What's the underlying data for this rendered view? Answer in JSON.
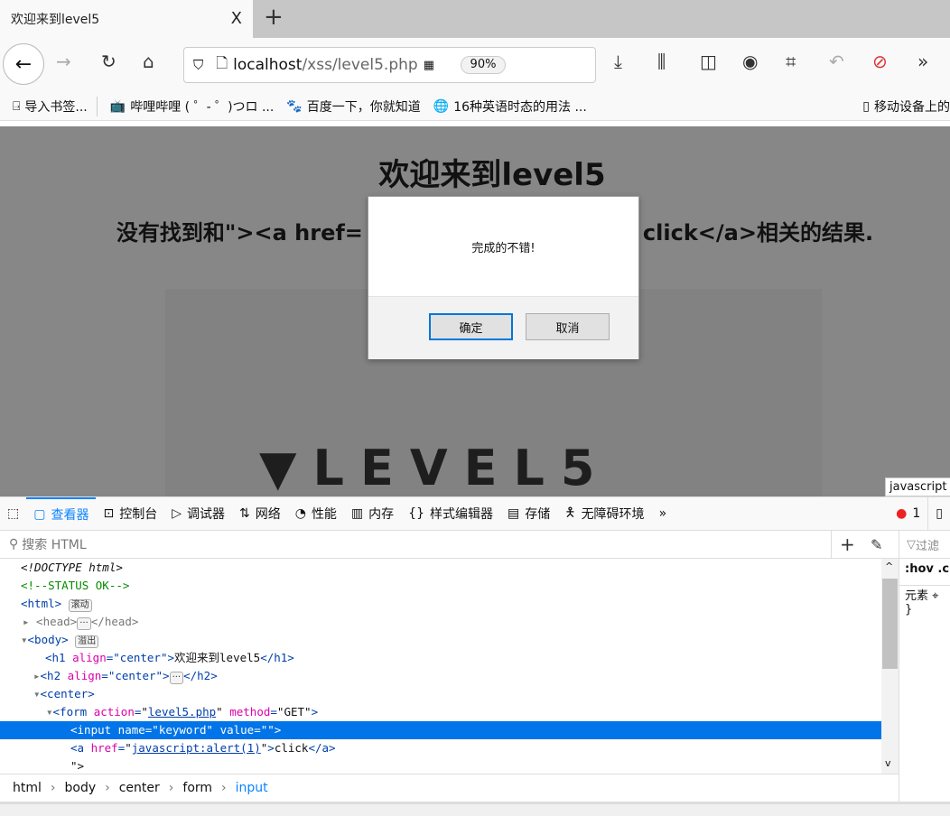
{
  "tab": {
    "title": "欢迎来到level5",
    "close": "X",
    "new": "+"
  },
  "nav": {
    "url_host": "localhost",
    "url_path": "/xss/level5.php",
    "zoom": "90%"
  },
  "bookmarks": [
    "导入书签...",
    "哔哩哔哩 ( ゜- ゜)つロ ...",
    "百度一下，你就知道",
    "16种英语时态的用法 ...",
    "移动设备上的"
  ],
  "page": {
    "h1": "欢迎来到level5",
    "h2_left": "没有找到和\"><a href=",
    "h2_right": "click</a>相关的结果.",
    "logo": "LEVEL5",
    "tooltip": "javascript"
  },
  "dialog": {
    "message": "完成的不错!",
    "ok": "确定",
    "cancel": "取消"
  },
  "devtools": {
    "tabs": [
      "查看器",
      "控制台",
      "调试器",
      "网络",
      "性能",
      "内存",
      "样式编辑器",
      "存储",
      "无障碍环境"
    ],
    "error_count": "1",
    "search_placeholder": "搜索 HTML",
    "filter": "过滤",
    "hov": ":hov .c",
    "element": "元素",
    "brace": "}",
    "badges": {
      "scroll": "滚动",
      "overflow": "溢出"
    },
    "breadcrumbs": [
      "html",
      "body",
      "center",
      "form",
      "input"
    ]
  }
}
